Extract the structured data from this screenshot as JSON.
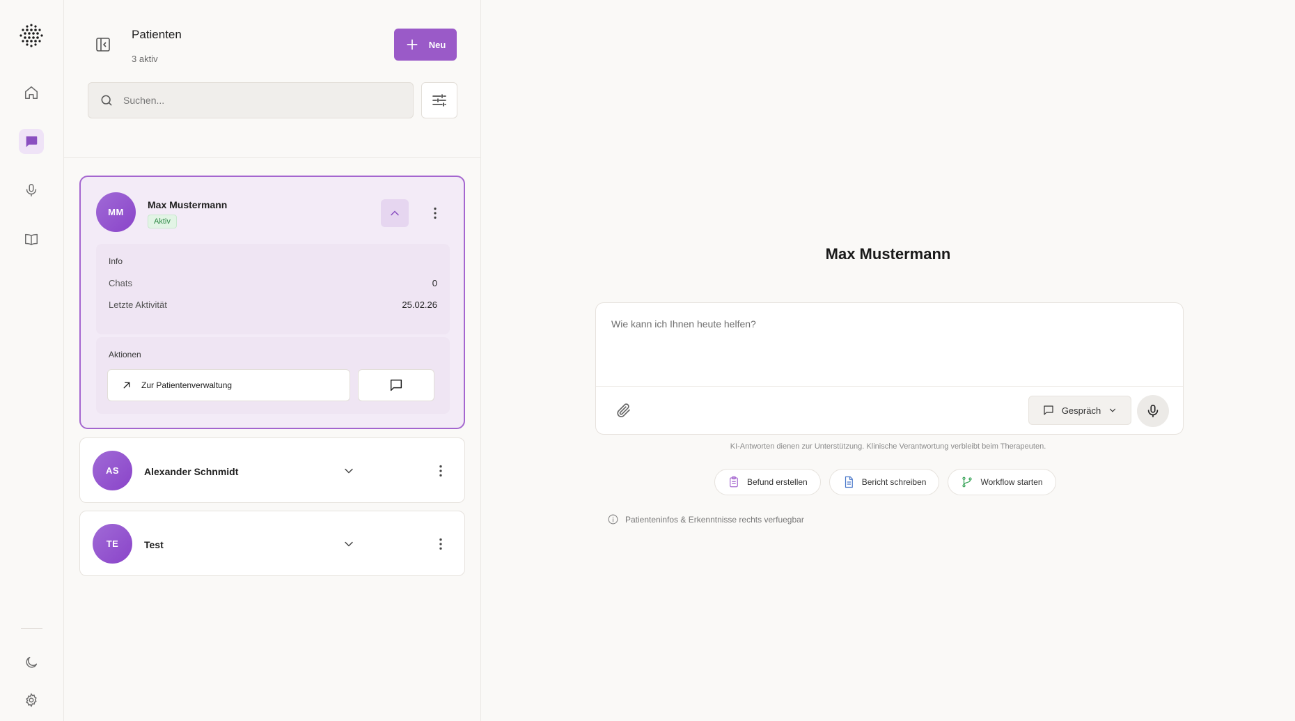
{
  "panel": {
    "title": "Patienten",
    "subtitle": "3 aktiv",
    "new_label": "Neu",
    "search_placeholder": "Suchen..."
  },
  "patients": [
    {
      "initials": "MM",
      "name": "Max Mustermann",
      "status": "Aktiv",
      "expanded": true,
      "info_label": "Info",
      "chats_label": "Chats",
      "chats_value": "0",
      "activity_label": "Letzte Aktivität",
      "activity_value": "25.02.26",
      "actions_label": "Aktionen",
      "open_admin_label": "Zur Patientenverwaltung"
    },
    {
      "initials": "AS",
      "name": "Alexander Schnmidt",
      "expanded": false
    },
    {
      "initials": "TE",
      "name": "Test",
      "expanded": false
    }
  ],
  "main": {
    "title": "Max Mustermann",
    "composer_placeholder": "Wie kann ich Ihnen heute helfen?",
    "mode_label": "Gespräch",
    "disclaimer": "KI-Antworten dienen zur Unterstützung. Klinische Verantwortung verbleibt beim Therapeuten.",
    "chips": [
      {
        "label": "Befund erstellen",
        "icon": "clipboard-icon",
        "color": "#a466cf"
      },
      {
        "label": "Bericht schreiben",
        "icon": "document-icon",
        "color": "#4a78c9"
      },
      {
        "label": "Workflow starten",
        "icon": "branch-icon",
        "color": "#3aa55a"
      }
    ],
    "hint": "Patienteninfos & Erkenntnisse rechts verfuegbar"
  },
  "colors": {
    "accent": "#9a5ac8",
    "accent_light": "#efe3f7",
    "success": "#2f8a46"
  }
}
